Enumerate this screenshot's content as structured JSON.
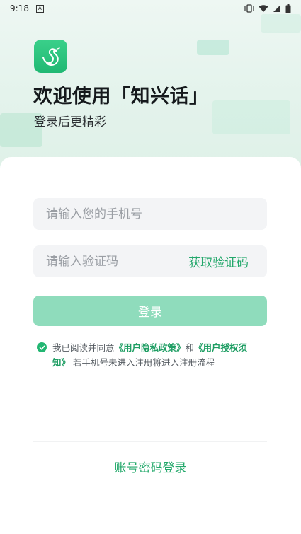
{
  "status_bar": {
    "time": "9:18",
    "notification_icon": "A",
    "icons": [
      "vibrate-icon",
      "wifi-icon",
      "signal-icon",
      "battery-icon"
    ]
  },
  "header": {
    "title": "欢迎使用「知兴话」",
    "subtitle": "登录后更精彩"
  },
  "form": {
    "phone_placeholder": "请输入您的手机号",
    "code_placeholder": "请输入验证码",
    "get_code_label": "获取验证码",
    "login_label": "登录"
  },
  "agreement": {
    "prefix": "我已阅读并同意",
    "privacy_link": "《用户隐私政策》",
    "and": "和",
    "auth_link": "《用户授权须知》",
    "suffix": "若手机号未进入注册将进入注册流程",
    "checked": true
  },
  "alt_login": "账号密码登录",
  "colors": {
    "accent": "#22a86a",
    "button_disabled": "#8fdcbc",
    "field_bg": "#f3f4f6"
  }
}
